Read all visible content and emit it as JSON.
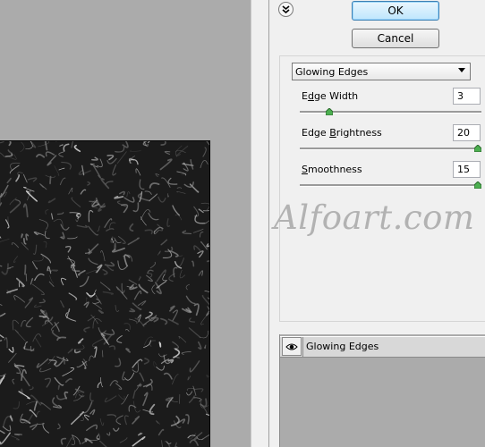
{
  "buttons": {
    "ok": "OK",
    "cancel": "Cancel"
  },
  "filter": {
    "selected": "Glowing Edges"
  },
  "params": [
    {
      "label_pre": "E",
      "label_ul": "d",
      "label_post": "ge Width",
      "value": "3",
      "slider_level": 0.15
    },
    {
      "label_pre": "Edge ",
      "label_ul": "B",
      "label_post": "rightness",
      "value": "20",
      "slider_level": 1.0
    },
    {
      "label_pre": "",
      "label_ul": "S",
      "label_post": "moothness",
      "value": "15",
      "slider_level": 1.0
    }
  ],
  "watermark": "Alfoart.com",
  "layer": {
    "name": "Glowing Edges"
  },
  "icons": {
    "collapse": "double-chevron-down-icon",
    "visibility": "eye-icon",
    "dropdown": "triangle-down-icon"
  }
}
